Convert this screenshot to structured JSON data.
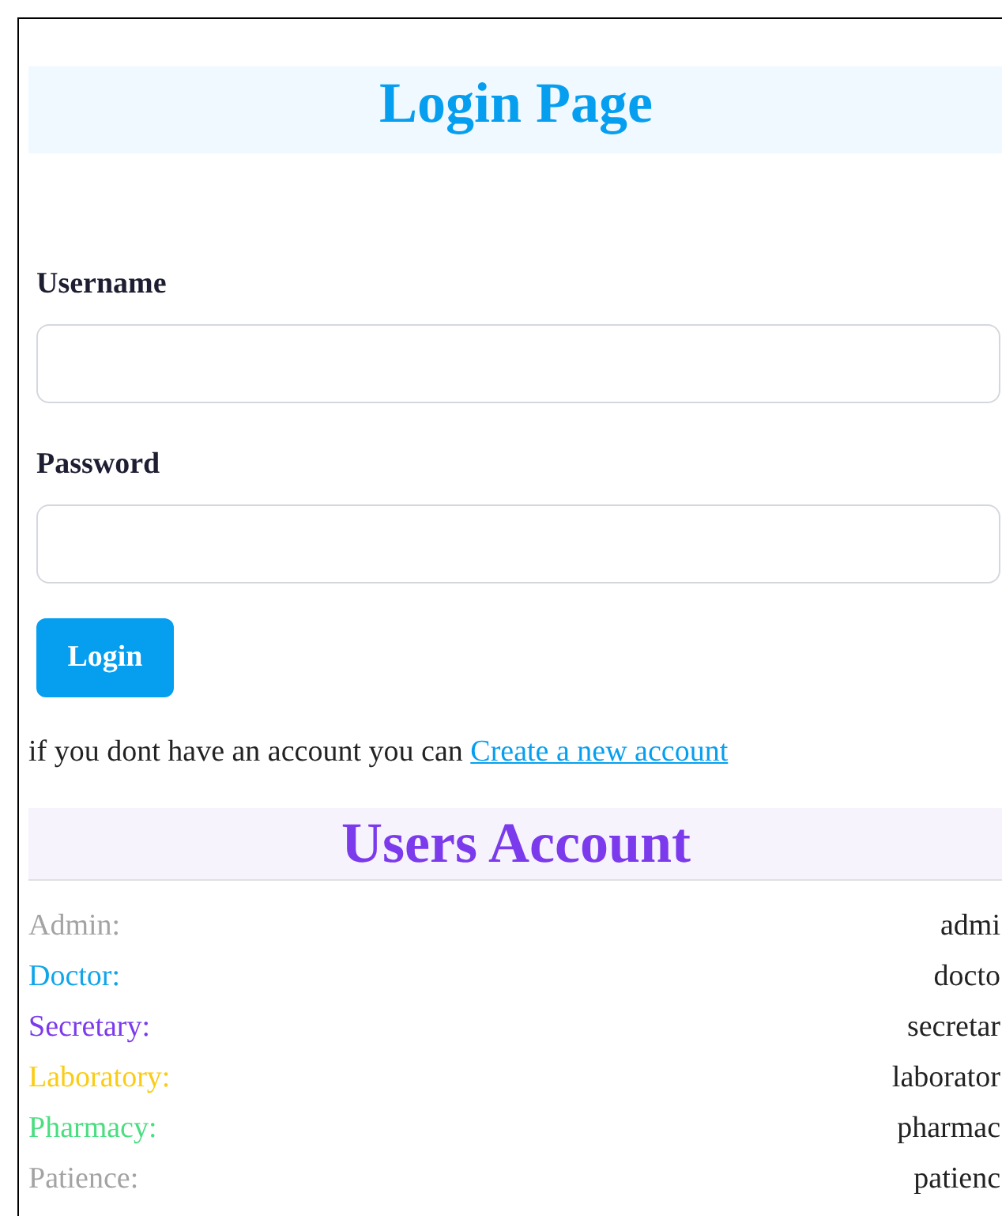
{
  "page_title": "Login Page",
  "form": {
    "fields": [
      {
        "label": "Username"
      },
      {
        "label": "Password"
      }
    ],
    "submit": "Login"
  },
  "signup_prompt": {
    "text": "if you dont have an account you can",
    "link": "Create a new account"
  },
  "accounts": {
    "title": "Users Account",
    "items": [
      {
        "role": "Admin:",
        "color": "#a3a3a3",
        "value": "admi"
      },
      {
        "role": "Doctor:",
        "color": "#0ea5e9",
        "value": "docto"
      },
      {
        "role": "Secretary:",
        "color": "#7c3aed",
        "value": "secretar"
      },
      {
        "role": "Laboratory:",
        "color": "#facc15",
        "value": "laborator"
      },
      {
        "role": "Pharmacy:",
        "color": "#4ade80",
        "value": "pharmac"
      },
      {
        "role": "Patience:",
        "color": "#a3a3a3",
        "value": "patienc"
      }
    ]
  }
}
